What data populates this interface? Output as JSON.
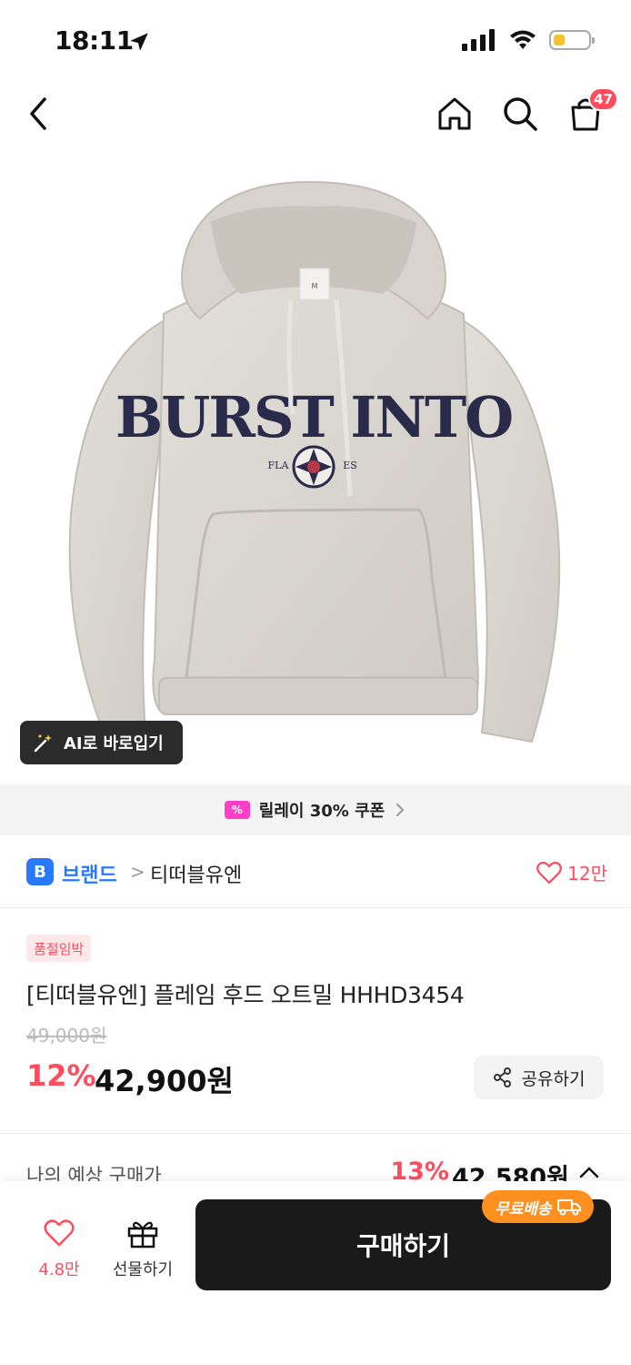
{
  "status_bar": {
    "time": "18:11"
  },
  "nav": {
    "cart_count": "47"
  },
  "product_image": {
    "print_text": "BURST INTO",
    "print_sub_left": "FLA",
    "print_sub_right": "ES",
    "tag_size": "M"
  },
  "ai_tryon": {
    "label": "AI로 바로입기"
  },
  "coupon": {
    "label": "릴레이 30% 쿠폰",
    "icon_text": "%"
  },
  "brand": {
    "badge": "B",
    "label": "브랜드",
    "separator": ">",
    "name": "티떠블유엔",
    "like_count": "12만"
  },
  "product": {
    "stock_tag": "품절임박",
    "title": "[티떠블유엔] 플레임 후드 오트밀 HHHD3454",
    "original_price": "49,000원",
    "discount_rate": "12%",
    "sale_price": "42,900원",
    "share_label": "공유하기"
  },
  "estimate": {
    "label": "나의 예상 구매가",
    "rate": "13%",
    "price": "42,580원"
  },
  "bottom_bar": {
    "like_count": "4.8만",
    "gift_label": "선물하기",
    "buy_label": "구매하기",
    "free_shipping": "무료배송"
  },
  "colors": {
    "accent_red": "#ff4d5e",
    "brand_blue": "#2979ff",
    "coupon_pink": "#ff3ec8",
    "shipping_orange": "#ff8f1f",
    "buy_button": "#1a1a1a"
  }
}
